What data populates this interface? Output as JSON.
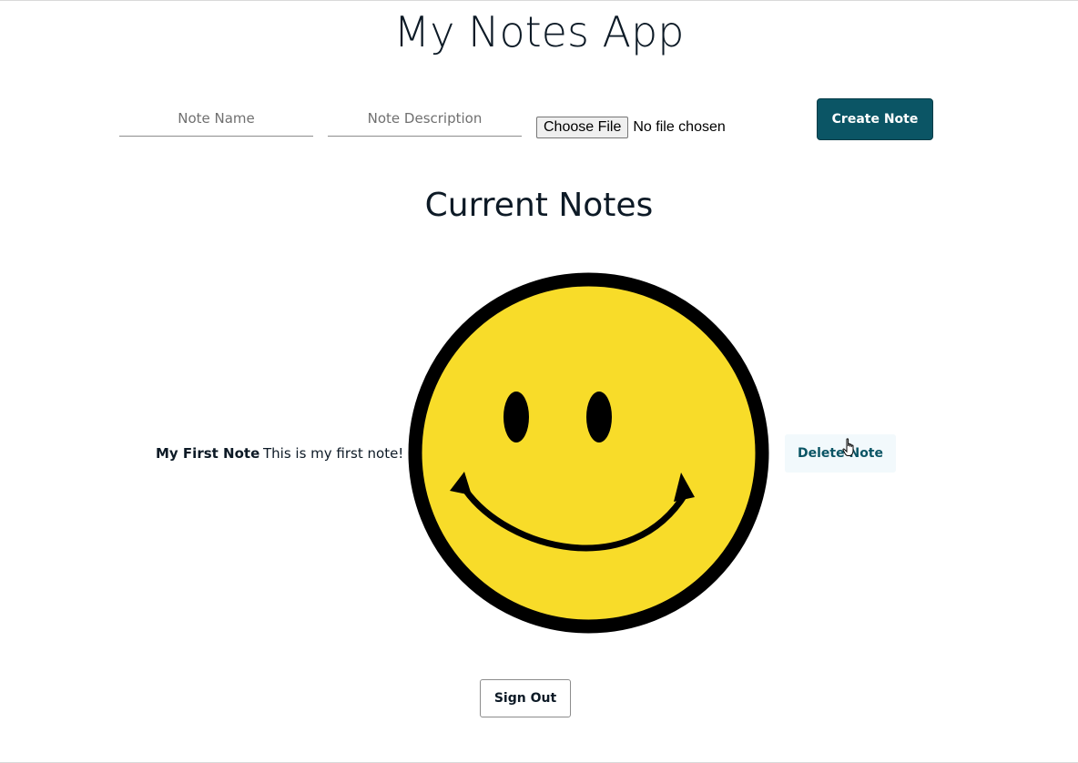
{
  "header": {
    "title": "My Notes App"
  },
  "form": {
    "note_name_placeholder": "Note Name",
    "note_description_placeholder": "Note Description",
    "file_button_label": "Choose File",
    "file_status": "No file chosen",
    "create_label": "Create Note"
  },
  "notes_section": {
    "title": "Current Notes",
    "notes": [
      {
        "name": "My First Note",
        "description": "This is my first note!",
        "image_icon": "smiley-face-icon",
        "delete_label": "Delete Note"
      }
    ]
  },
  "footer": {
    "sign_out_label": "Sign Out"
  },
  "colors": {
    "primary": "#0b5565",
    "delete_bg": "#f2f9fc",
    "smiley_fill": "#f8dc29",
    "text": "#0d1a26"
  }
}
